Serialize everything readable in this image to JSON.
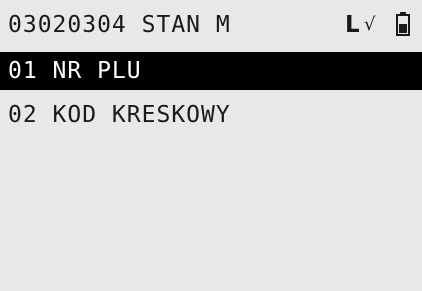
{
  "header": {
    "title": "03020304 STAN M",
    "status_l": "L",
    "status_check": "√",
    "battery_icon": "battery-icon"
  },
  "menu": {
    "items": [
      {
        "label": "01 NR PLU",
        "selected": true
      },
      {
        "label": "02 KOD KRESKOWY",
        "selected": false
      }
    ]
  },
  "colors": {
    "background": "#e8e8e8",
    "text": "#1a1a1a",
    "selection_bg": "#000000",
    "selection_text": "#ffffff"
  }
}
